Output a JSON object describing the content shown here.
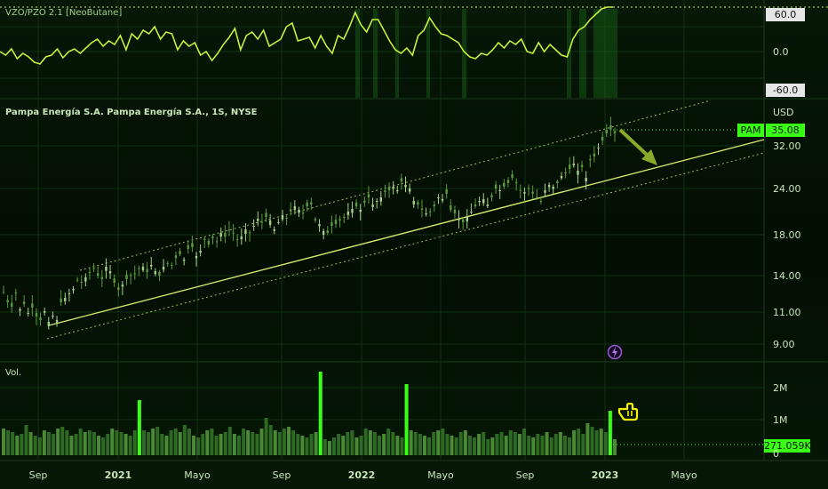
{
  "indicator": {
    "title": "VZO/PZO 2.1 [NeoButane]",
    "levels": [
      "60.0",
      "0.0",
      "-60.0"
    ],
    "top_label": "60.0",
    "bottom_label": "-60.0"
  },
  "main": {
    "title": "Pampa Energía S.A. Pampa Energía S.A., 1S, NYSE",
    "currency": "USD",
    "ticker": "PAM",
    "last_price": "35.08",
    "price_ticks": [
      "32.00",
      "24.00",
      "18.00",
      "14.00",
      "11.00",
      "9.00"
    ]
  },
  "volume": {
    "title": "Vol.",
    "ticks": [
      "2M",
      "1M",
      "0"
    ],
    "last_value": "271.059K"
  },
  "x_axis": [
    {
      "label": "Sep",
      "bold": false
    },
    {
      "label": "2021",
      "bold": true
    },
    {
      "label": "Mayo",
      "bold": false
    },
    {
      "label": "Sep",
      "bold": false
    },
    {
      "label": "2022",
      "bold": true
    },
    {
      "label": "Mayo",
      "bold": false
    },
    {
      "label": "Sep",
      "bold": false
    },
    {
      "label": "2023",
      "bold": true
    },
    {
      "label": "Mayo",
      "bold": false
    }
  ],
  "icons": [
    "lightning-icon",
    "hand-pointer-icon",
    "arrow-down-right-icon"
  ],
  "colors": {
    "background": "#000000",
    "accent": "#39ff14",
    "up_candle": "#a8d08c",
    "indicator_line": "#c8f03c",
    "channel_line": "#d4e86a"
  }
}
